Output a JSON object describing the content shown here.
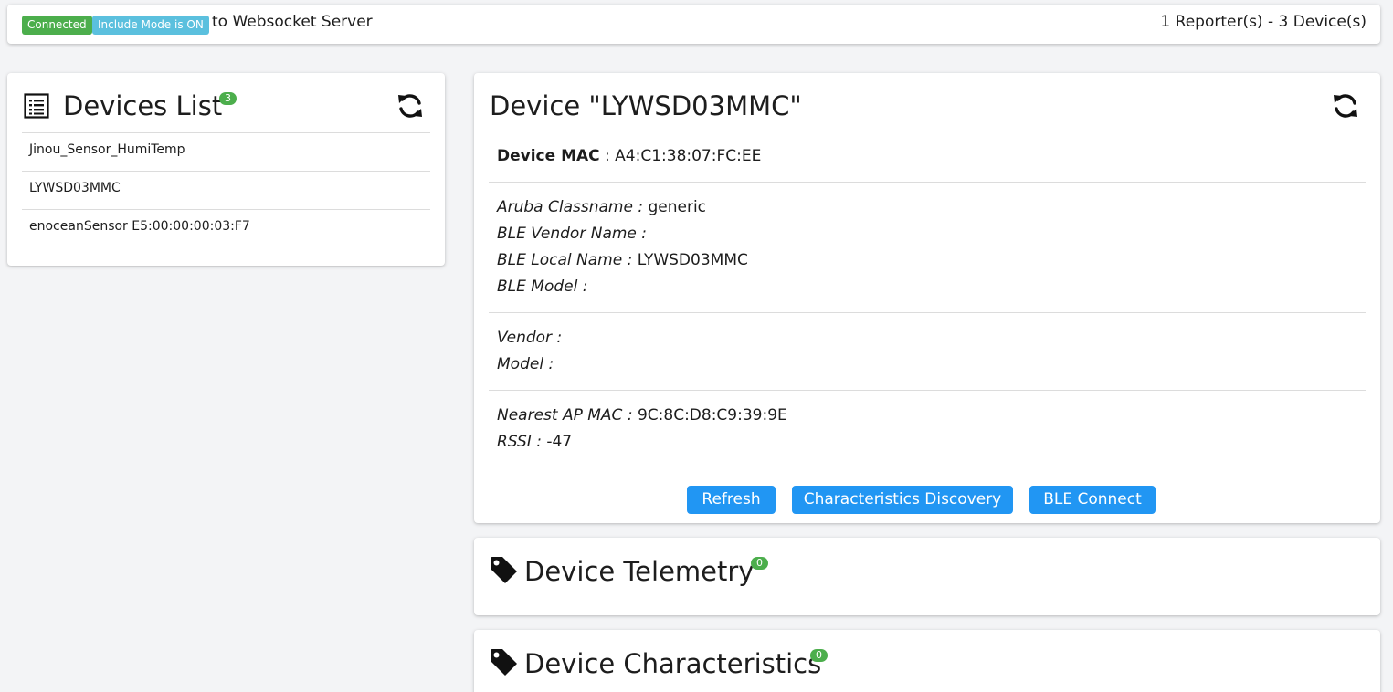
{
  "topbar": {
    "badge_connected": "Connected",
    "badge_include": "Include Mode is ON",
    "status_text": "to Websocket Server",
    "counts_text": "1 Reporter(s) - 3 Device(s)"
  },
  "devices_list": {
    "title": "Devices List",
    "count": "3",
    "items": [
      {
        "label": "Jinou_Sensor_HumiTemp"
      },
      {
        "label": "LYWSD03MMC"
      },
      {
        "label": "enoceanSensor E5:00:00:00:03:F7"
      }
    ]
  },
  "device": {
    "title": "Device \"LYWSD03MMC\"",
    "mac_label": "Device MAC",
    "mac_value": "A4:C1:38:07:FC:EE",
    "aruba_classname_label": "Aruba Classname :",
    "aruba_classname_value": "generic",
    "ble_vendor_name_label": "BLE Vendor Name :",
    "ble_vendor_name_value": "",
    "ble_local_name_label": "BLE Local Name :",
    "ble_local_name_value": "LYWSD03MMC",
    "ble_model_label": "BLE Model :",
    "ble_model_value": "",
    "vendor_label": "Vendor :",
    "vendor_value": "",
    "model_label": "Model :",
    "model_value": "",
    "nearest_ap_label": "Nearest AP MAC :",
    "nearest_ap_value": "9C:8C:D8:C9:39:9E",
    "rssi_label": "RSSI :",
    "rssi_value": "-47",
    "buttons": {
      "refresh": "Refresh",
      "discovery": "Characteristics Discovery",
      "connect": "BLE Connect"
    }
  },
  "telemetry": {
    "title": "Device Telemetry",
    "count": "0"
  },
  "characteristics": {
    "title": "Device Characteristics",
    "count": "0"
  },
  "colors": {
    "green": "#4cae4c",
    "cyan": "#5bc0de",
    "blue": "#2196f3"
  }
}
